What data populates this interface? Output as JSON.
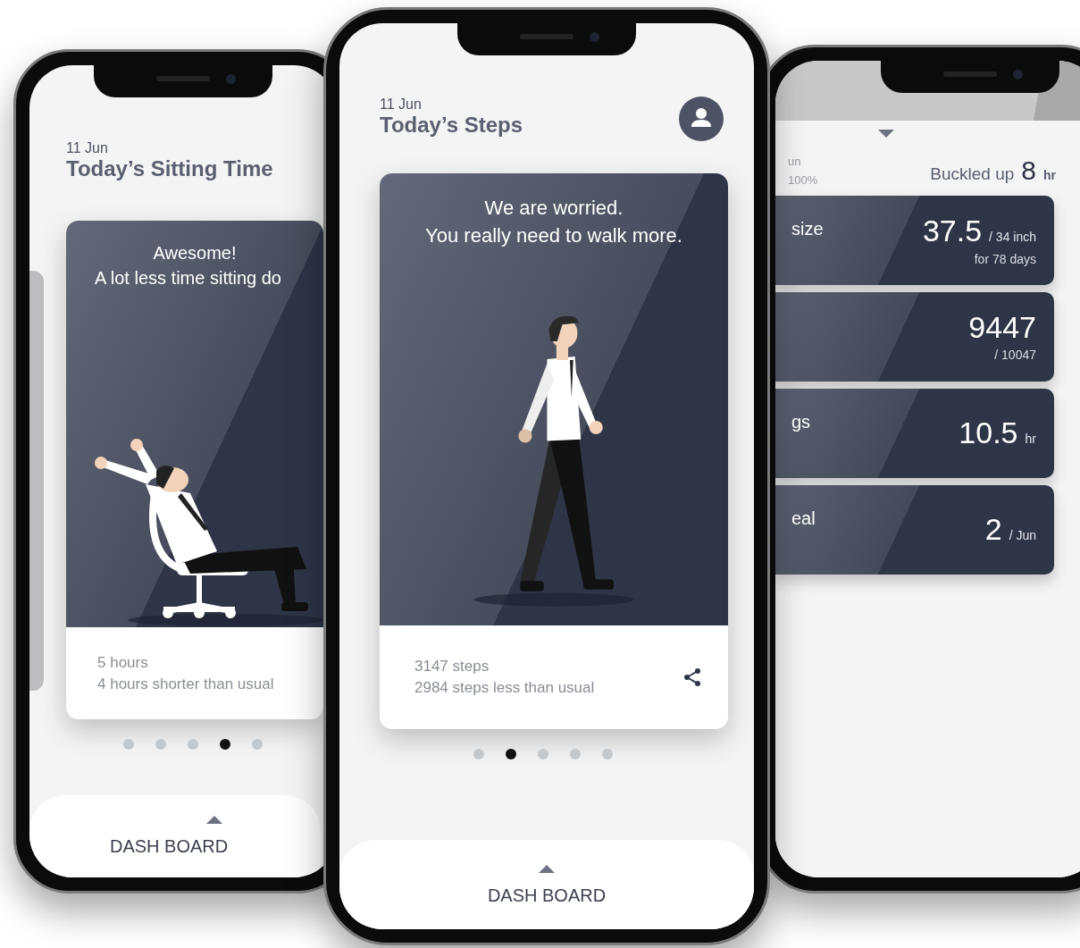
{
  "phones": [
    {
      "kind": "story",
      "previous_card": true,
      "date": "11 Jun",
      "title": "Today’s Sitting Time",
      "card": {
        "kind": "sitting",
        "headline": "Awesome!",
        "message": "A lot less time sitting do",
        "value": "5 hours",
        "comparison": "4 hours shorter than usual"
      },
      "dots": [
        {
          "selected": false
        },
        {
          "selected": false
        },
        {
          "selected": false
        },
        {
          "selected": true
        },
        {
          "selected": false
        }
      ],
      "dashboard": "DASH BOARD"
    },
    {
      "kind": "story",
      "profile": true,
      "date": "11 Jun",
      "title": "Today’s Steps",
      "card": {
        "kind": "walking",
        "headline": "We are worried.",
        "message": "You really need to walk more.",
        "value": "3147 steps",
        "comparison": "2984 steps less than usual",
        "share": true
      },
      "dots": [
        {
          "selected": false
        },
        {
          "selected": true
        },
        {
          "selected": false
        },
        {
          "selected": false
        },
        {
          "selected": false
        }
      ],
      "dashboard": "DASH BOARD"
    },
    {
      "kind": "stats",
      "date": "un",
      "percent": "100%",
      "summary_label": "Buckled up",
      "summary_value": "8",
      "summary_unit": "hr",
      "stats": [
        {
          "label": "size",
          "value": "37.5",
          "unit": "/ 34 inch",
          "note": "for 78 days"
        },
        {
          "value": "9447",
          "note": "/ 10047"
        },
        {
          "label": "gs",
          "value": "10.5",
          "unit": "hr"
        },
        {
          "label": "eal",
          "value": "2",
          "unit": "/ Jun"
        }
      ]
    }
  ]
}
